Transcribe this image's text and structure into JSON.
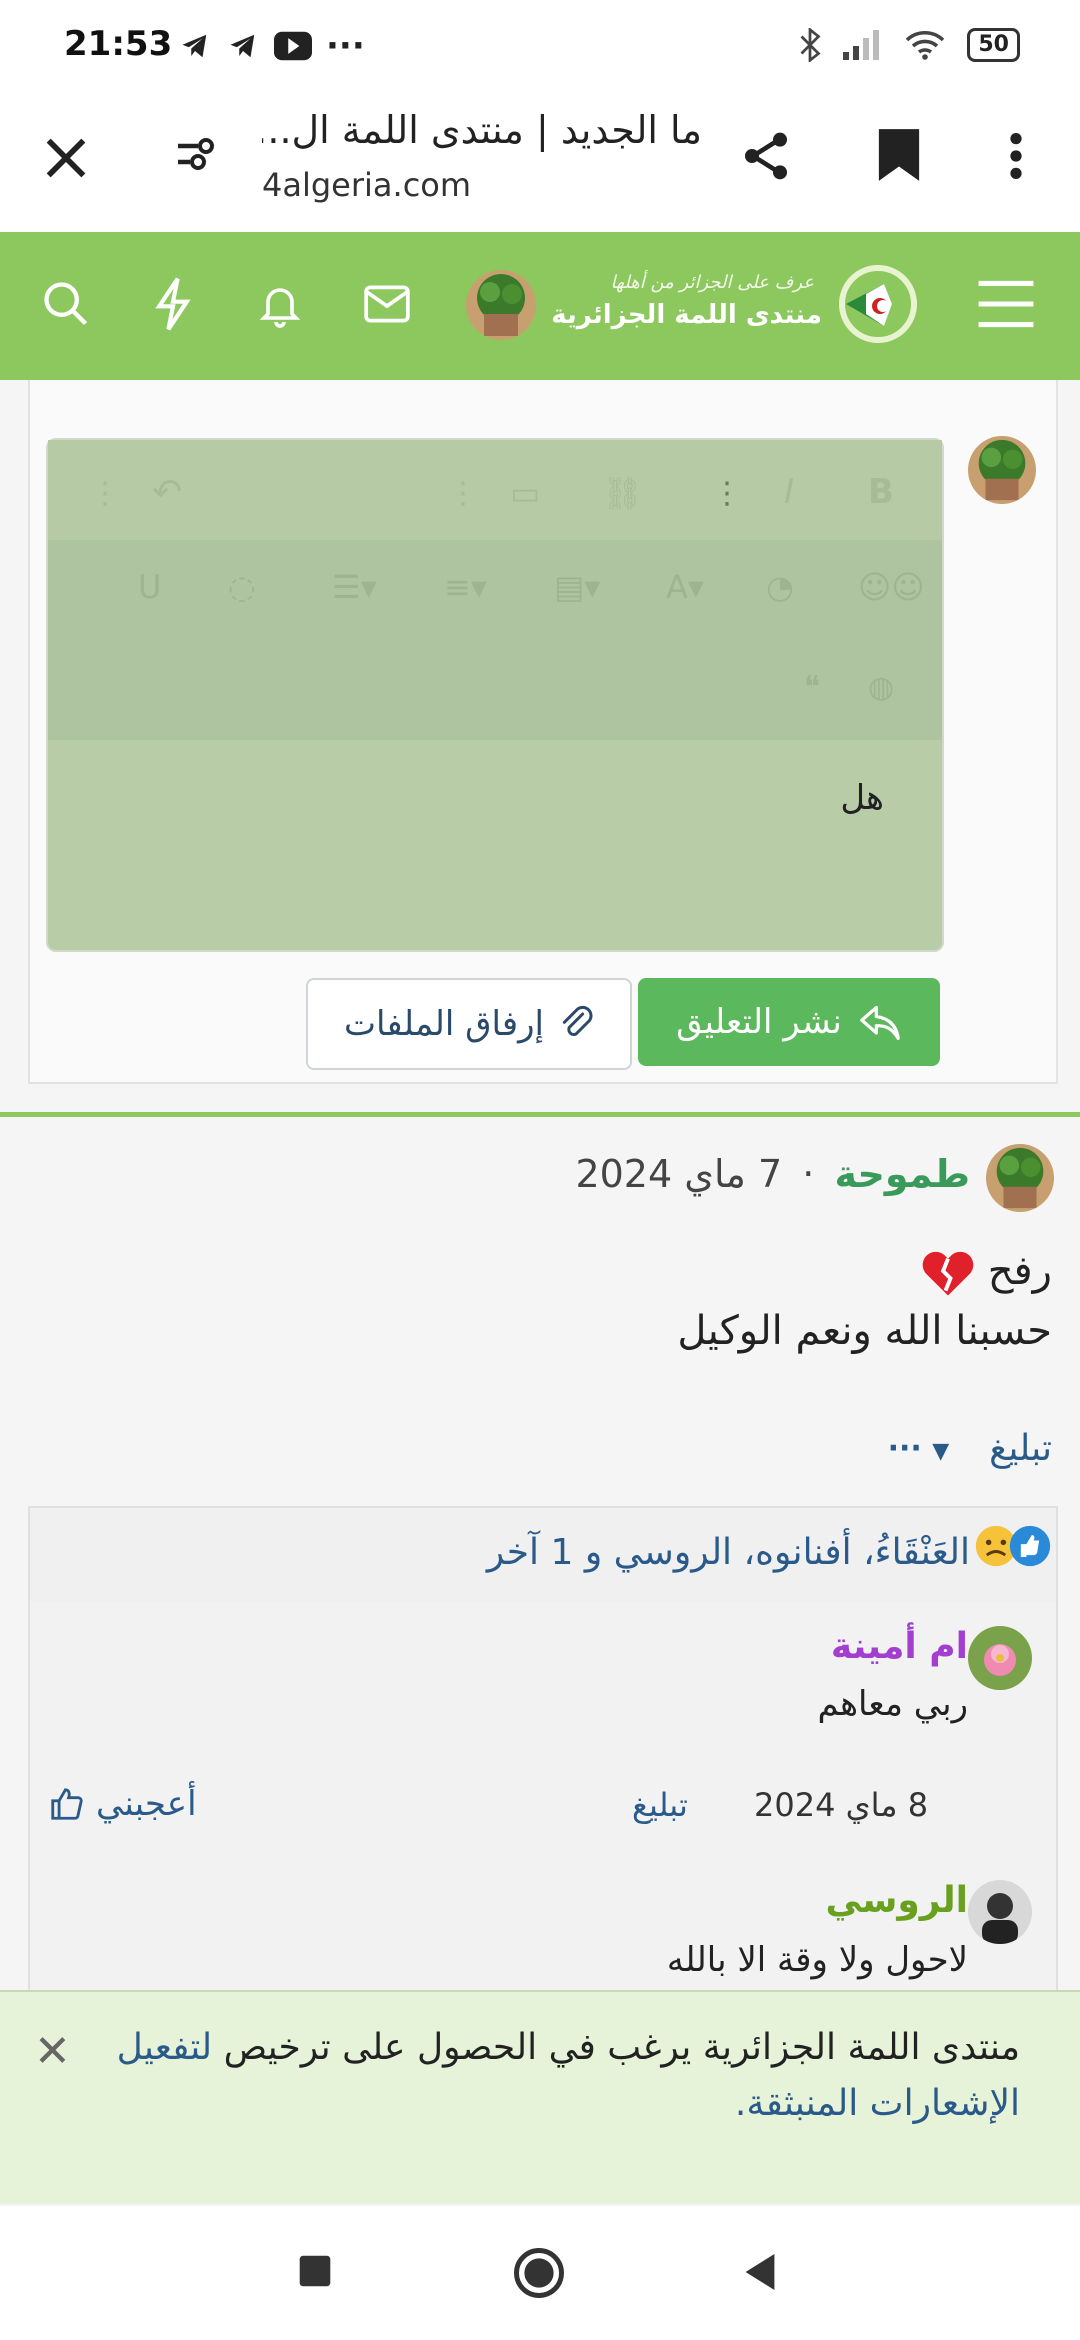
{
  "status_bar": {
    "time": "21:53",
    "battery": "50"
  },
  "browser": {
    "title": "ما الجديد | منتدى اللمة ال...",
    "url": "4algeria.com"
  },
  "site": {
    "logo_line1": "عرف على الجزائر من أهلها",
    "logo_line2": "منتدى اللمة الجزائرية"
  },
  "editor": {
    "text": "هل"
  },
  "buttons": {
    "post": "نشر التعليق",
    "attach": "إرفاق الملفات"
  },
  "post": {
    "author": "طموحة",
    "separator": "·",
    "date": "7 ماي 2024",
    "line1": "رفح",
    "line2": "حسبنا الله ونعم الوكيل",
    "report": "تبليغ",
    "more": "···"
  },
  "reactions": {
    "text": "العَنْقَاءُ، أفنانوه، الروسي و 1 آخر"
  },
  "comments": [
    {
      "author": "ام أمينة",
      "text": "ربي معاهم",
      "date": "8 ماي 2024",
      "report": "تبليغ",
      "like": "أعجبني"
    },
    {
      "author": "الروسي",
      "text": "لاحول ولا وقة الا بالله"
    }
  ],
  "notification": {
    "text": "منتدى اللمة الجزائرية يرغب في الحصول على ترخيص ",
    "link": "لتفعيل الإشعارات المنبثقة."
  },
  "colors": {
    "header_green": "#8cc85e",
    "post_button": "#5cb85c",
    "author_teal": "#3a9a5a",
    "comment_author_purple": "#a23fd0",
    "comment_author_green": "#6aa020",
    "link_blue": "#2a5a8a"
  }
}
